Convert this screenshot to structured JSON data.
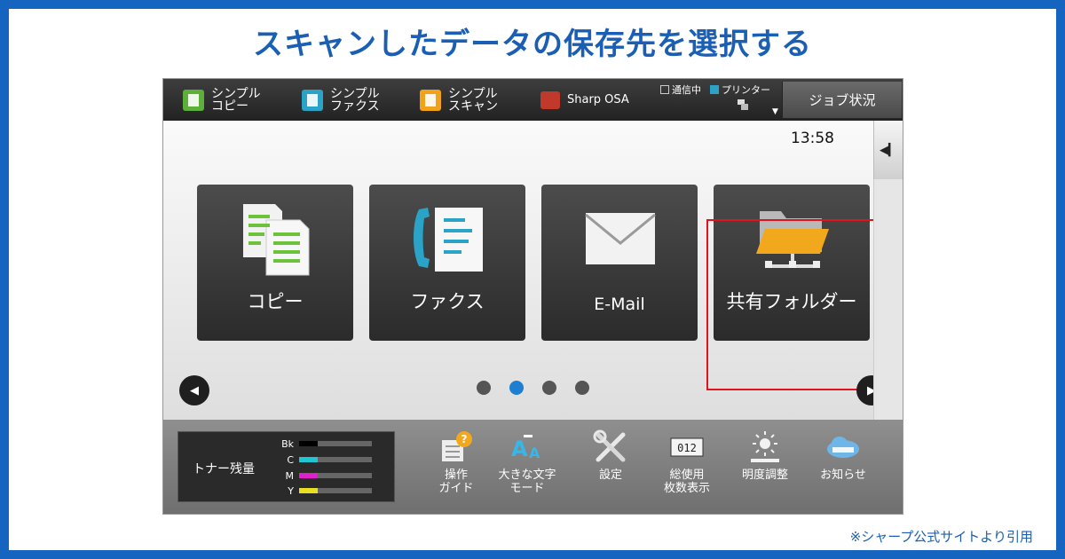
{
  "headline": "スキャンしたデータの保存先を選択する",
  "credit": "※シャープ公式サイトより引用",
  "topbar": {
    "quick": [
      {
        "label": "シンプル\nコピー",
        "color": "#5cb03a"
      },
      {
        "label": "シンプル\nファクス",
        "color": "#2aa3c7"
      },
      {
        "label": "シンプル\nスキャン",
        "color": "#f0a31a"
      },
      {
        "label": "Sharp OSA",
        "color": "#c0392b"
      }
    ],
    "status_comm": "通信中",
    "status_printer": "プリンター",
    "job_status": "ジョブ状況"
  },
  "clock": "13:58",
  "tiles": [
    {
      "label": "コピー"
    },
    {
      "label": "ファクス"
    },
    {
      "label": "E-Mail"
    },
    {
      "label": "共有フォルダー"
    }
  ],
  "pager": {
    "count": 4,
    "active": 1
  },
  "toner": {
    "title": "トナー残量",
    "levels": [
      {
        "key": "Bk",
        "color": "#000000",
        "level": 0.25
      },
      {
        "key": "C",
        "color": "#1fc7d4",
        "level": 0.25
      },
      {
        "key": "M",
        "color": "#e020c8",
        "level": 0.25
      },
      {
        "key": "Y",
        "color": "#e8e020",
        "level": 0.25
      }
    ]
  },
  "tools": [
    {
      "label": "操作\nガイド"
    },
    {
      "label": "大きな文字\nモード"
    },
    {
      "label": "設定"
    },
    {
      "label": "総使用\n枚数表示"
    },
    {
      "label": "明度調整"
    },
    {
      "label": "お知らせ"
    }
  ],
  "icons": {
    "counter_digits": "012"
  }
}
